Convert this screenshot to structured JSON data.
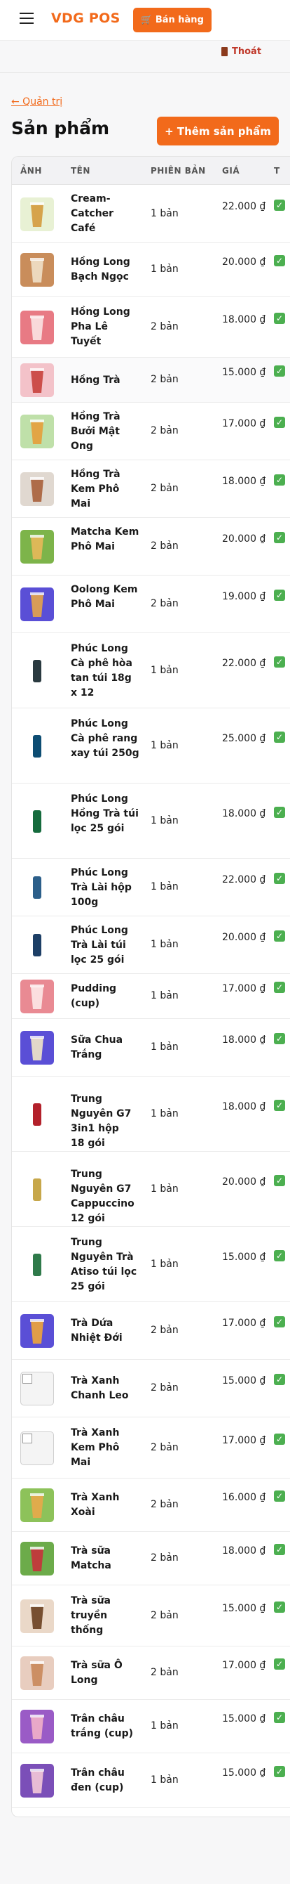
{
  "header": {
    "brand": "VDG POS",
    "sell_label": "🛒 Bán hàng",
    "logout_label": "Thoát"
  },
  "page": {
    "back_label": "← Quản trị",
    "title": "Sản phẩm",
    "add_label": "+ Thêm sản phẩm"
  },
  "table": {
    "headers": [
      "ẢNH",
      "TÊN",
      "PHIÊN BẢN",
      "GIÁ"
    ],
    "rows": [
      {
        "name": "Cream-Catcher Café",
        "versions": "1 bản",
        "price": "22.000 ₫",
        "thumb": {
          "bg": "#e8f1d4",
          "accent": "#d49a3c"
        }
      },
      {
        "name": "Hồng Long Bạch Ngọc",
        "versions": "1 bản",
        "price": "20.000 ₫",
        "thumb": {
          "bg": "#c98d5b",
          "accent": "#f0e0c8"
        }
      },
      {
        "name": "Hồng Long Pha Lê Tuyết",
        "versions": "2 bản",
        "price": "18.000 ₫",
        "thumb": {
          "bg": "#e87a84",
          "accent": "#fbe3e3"
        }
      },
      {
        "name": "Hồng Trà",
        "versions": "2 bản",
        "price": "15.000 ₫",
        "thumb": {
          "bg": "#f3c2c9",
          "accent": "#c8413c"
        }
      },
      {
        "name": "Hồng Trà Bưởi Mật Ong",
        "versions": "2 bản",
        "price": "17.000 ₫",
        "thumb": {
          "bg": "#bfe0a9",
          "accent": "#e59e3a"
        }
      },
      {
        "name": "Hồng Trà Kem Phô Mai",
        "versions": "2 bản",
        "price": "18.000 ₫",
        "thumb": {
          "bg": "#e0d8d0",
          "accent": "#a8603a"
        }
      },
      {
        "name": "Matcha Kem Phô Mai",
        "versions": "2 bản",
        "price": "20.000 ₫",
        "thumb": {
          "bg": "#7db44a",
          "accent": "#e8b85a"
        }
      },
      {
        "name": "Oolong Kem Phô Mai",
        "versions": "2 bản",
        "price": "19.000 ₫",
        "thumb": {
          "bg": "#5a4fd6",
          "accent": "#e5a44a"
        }
      },
      {
        "name": "Phúc Long Cà phê hòa tan túi 18g x 12",
        "versions": "1 bản",
        "price": "22.000 ₫",
        "thumb": {
          "bg": "#ffffff",
          "accent": "#2a3a40"
        }
      },
      {
        "name": "Phúc Long Cà phê rang xay túi 250g",
        "versions": "1 bản",
        "price": "25.000 ₫",
        "thumb": {
          "bg": "#ffffff",
          "accent": "#0d4d73"
        }
      },
      {
        "name": "Phúc Long Hồng Trà túi lọc 25 gói",
        "versions": "1 bản",
        "price": "18.000 ₫",
        "thumb": {
          "bg": "#ffffff",
          "accent": "#156b3d"
        }
      },
      {
        "name": "Phúc Long Trà Lài hộp 100g",
        "versions": "1 bản",
        "price": "22.000 ₫",
        "thumb": {
          "bg": "#ffffff",
          "accent": "#2c5f8a"
        }
      },
      {
        "name": "Phúc Long Trà Lài túi lọc 25 gói",
        "versions": "1 bản",
        "price": "20.000 ₫",
        "thumb": {
          "bg": "#ffffff",
          "accent": "#1d3f66"
        }
      },
      {
        "name": "Pudding (cup)",
        "versions": "1 bản",
        "price": "17.000 ₫",
        "thumb": {
          "bg": "#e98a93",
          "accent": "#fde8e8"
        }
      },
      {
        "name": "Sữa Chua Trắng",
        "versions": "1 bản",
        "price": "18.000 ₫",
        "thumb": {
          "bg": "#5a4fd6",
          "accent": "#f1e6c8"
        }
      },
      {
        "name": "Trung Nguyên G7 3in1 hộp 18 gói",
        "versions": "1 bản",
        "price": "18.000 ₫",
        "thumb": {
          "bg": "#ffffff",
          "accent": "#b3212b"
        }
      },
      {
        "name": "Trung Nguyên G7 Cappuccino 12 gói",
        "versions": "1 bản",
        "price": "20.000 ₫",
        "thumb": {
          "bg": "#ffffff",
          "accent": "#c7a74a"
        }
      },
      {
        "name": "Trung Nguyên Trà Atiso túi lọc 25 gói",
        "versions": "1 bản",
        "price": "15.000 ₫",
        "thumb": {
          "bg": "#ffffff",
          "accent": "#2f7a4a"
        }
      },
      {
        "name": "Trà Dứa Nhiệt Đới",
        "versions": "2 bản",
        "price": "17.000 ₫",
        "thumb": {
          "bg": "#5a4fd6",
          "accent": "#f0a53a"
        }
      },
      {
        "name": "Trà Xanh Chanh Leo",
        "versions": "2 bản",
        "price": "15.000 ₫",
        "thumb": {
          "bg": "broken",
          "accent": ""
        }
      },
      {
        "name": "Trà Xanh Kem Phô Mai",
        "versions": "2 bản",
        "price": "17.000 ₫",
        "thumb": {
          "bg": "broken",
          "accent": ""
        }
      },
      {
        "name": "Trà Xanh Xoài",
        "versions": "2 bản",
        "price": "16.000 ₫",
        "thumb": {
          "bg": "#8dc25a",
          "accent": "#e8a94a"
        }
      },
      {
        "name": "Trà sữa Matcha",
        "versions": "2 bản",
        "price": "18.000 ₫",
        "thumb": {
          "bg": "#6cab4a",
          "accent": "#c8313b"
        }
      },
      {
        "name": "Trà sữa truyền thống",
        "versions": "2 bản",
        "price": "15.000 ₫",
        "thumb": {
          "bg": "#ead8c8",
          "accent": "#6a4020"
        }
      },
      {
        "name": "Trà sữa Ô Long",
        "versions": "2 bản",
        "price": "17.000 ₫",
        "thumb": {
          "bg": "#e8cdbf",
          "accent": "#c9885a"
        }
      },
      {
        "name": "Trân châu trắng (cup)",
        "versions": "1 bản",
        "price": "15.000 ₫",
        "thumb": {
          "bg": "#9a5bc6",
          "accent": "#f2b0c8"
        }
      },
      {
        "name": "Trân châu đen (cup)",
        "versions": "1 bản",
        "price": "15.000 ₫",
        "thumb": {
          "bg": "#7b4fb8",
          "accent": "#f4c8d8"
        }
      }
    ]
  }
}
